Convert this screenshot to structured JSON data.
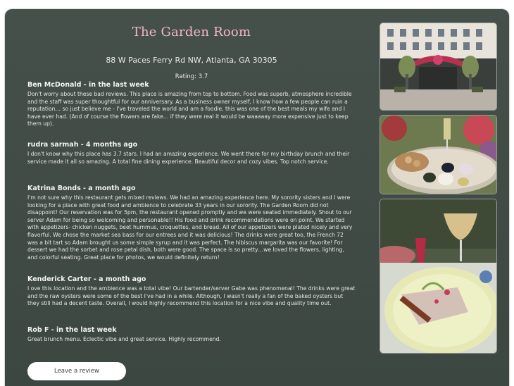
{
  "restaurant": {
    "name": "The Garden Room",
    "address": "88 W Paces Ferry Rd NW, Atlanta, GA 30305",
    "rating_text": "Rating: 3.7"
  },
  "reviews": [
    {
      "header": "Ben McDonald - in the last week",
      "text": "Don't worry about these bad reviews. This place is amazing from top to bottom. Food was superb, atmosphere incredible and the staff was super thoughtful for our anniversary. As a business owner myself, I know how a few people can ruin a reputation… so just believe me - I've traveled the world and am a foodie, this was one of the best meals my wife and I have ever had. (And of course the flowers are fake… if they were real it would be waaaaay more expensive just to keep them up)."
    },
    {
      "header": "rudra sarmah - 4 months ago",
      "text": "I don't know why this place has 3.7 stars. I had an amazing experience. We went there for my birthday brunch and their service made it all so amazing. A total fine dining experience. Beautiful decor and cozy vibes. Top notch service."
    },
    {
      "header": "Katrina Bonds - a month ago",
      "text": "I'm not sure why this restaurant gets mixed reviews. We had an amazing experience here. My sorority sisters and I were looking for a place with great food and ambience to celebrate 33 years in our sorority. The Garden Room did not disappoint! Our reservation was for 5pm, the restaurant opened promptly and we were seated immediately. Shout to our server Adam for being so welcoming and personable!! His food and drink recommendations were on point. We started with appetizers- chicken nuggets, beet hummus, croquettes, and bread. All of our appetizers were plated nicely and very flavorful. We chose the market sea bass for our entrees and it was delicious! The drinks were great too, the French 72 was a bit tart so Adam brought us some simple syrup and it was perfect. The hibiscus margarita was our favorite! For dessert we had the sorbet and rose petal dish, both were good. The space is so pretty…we loved the flowers, lighting, and colorful seating. Great place for photos, we would definitely return!"
    },
    {
      "header": "Kenderick Carter - a month ago",
      "text": "I ove this location and the ambience was a total vibe! Our bartender/server Gabe was phenomenal! The drinks were great and the raw oysters were some of the best I've had in a while. Although, I wasn't really a fan of the baked oysters but they still had a decent taste. Overall, I would highly recommend this location for a nice vibe and quality time out."
    },
    {
      "header": "Rob F - in the last week",
      "text": "Great brunch menu. Eclectic vibe and great service. Highly recommend."
    }
  ],
  "actions": {
    "leave_review_label": "Leave a review"
  },
  "photos": [
    {
      "icon": "restaurant-exterior-photo"
    },
    {
      "icon": "appetizer-tray-photo"
    },
    {
      "icon": "sea-bass-dish-photo"
    }
  ],
  "colors": {
    "panel": "#434d47",
    "title": "#f1b7c4",
    "text": "#e6e8e4"
  }
}
